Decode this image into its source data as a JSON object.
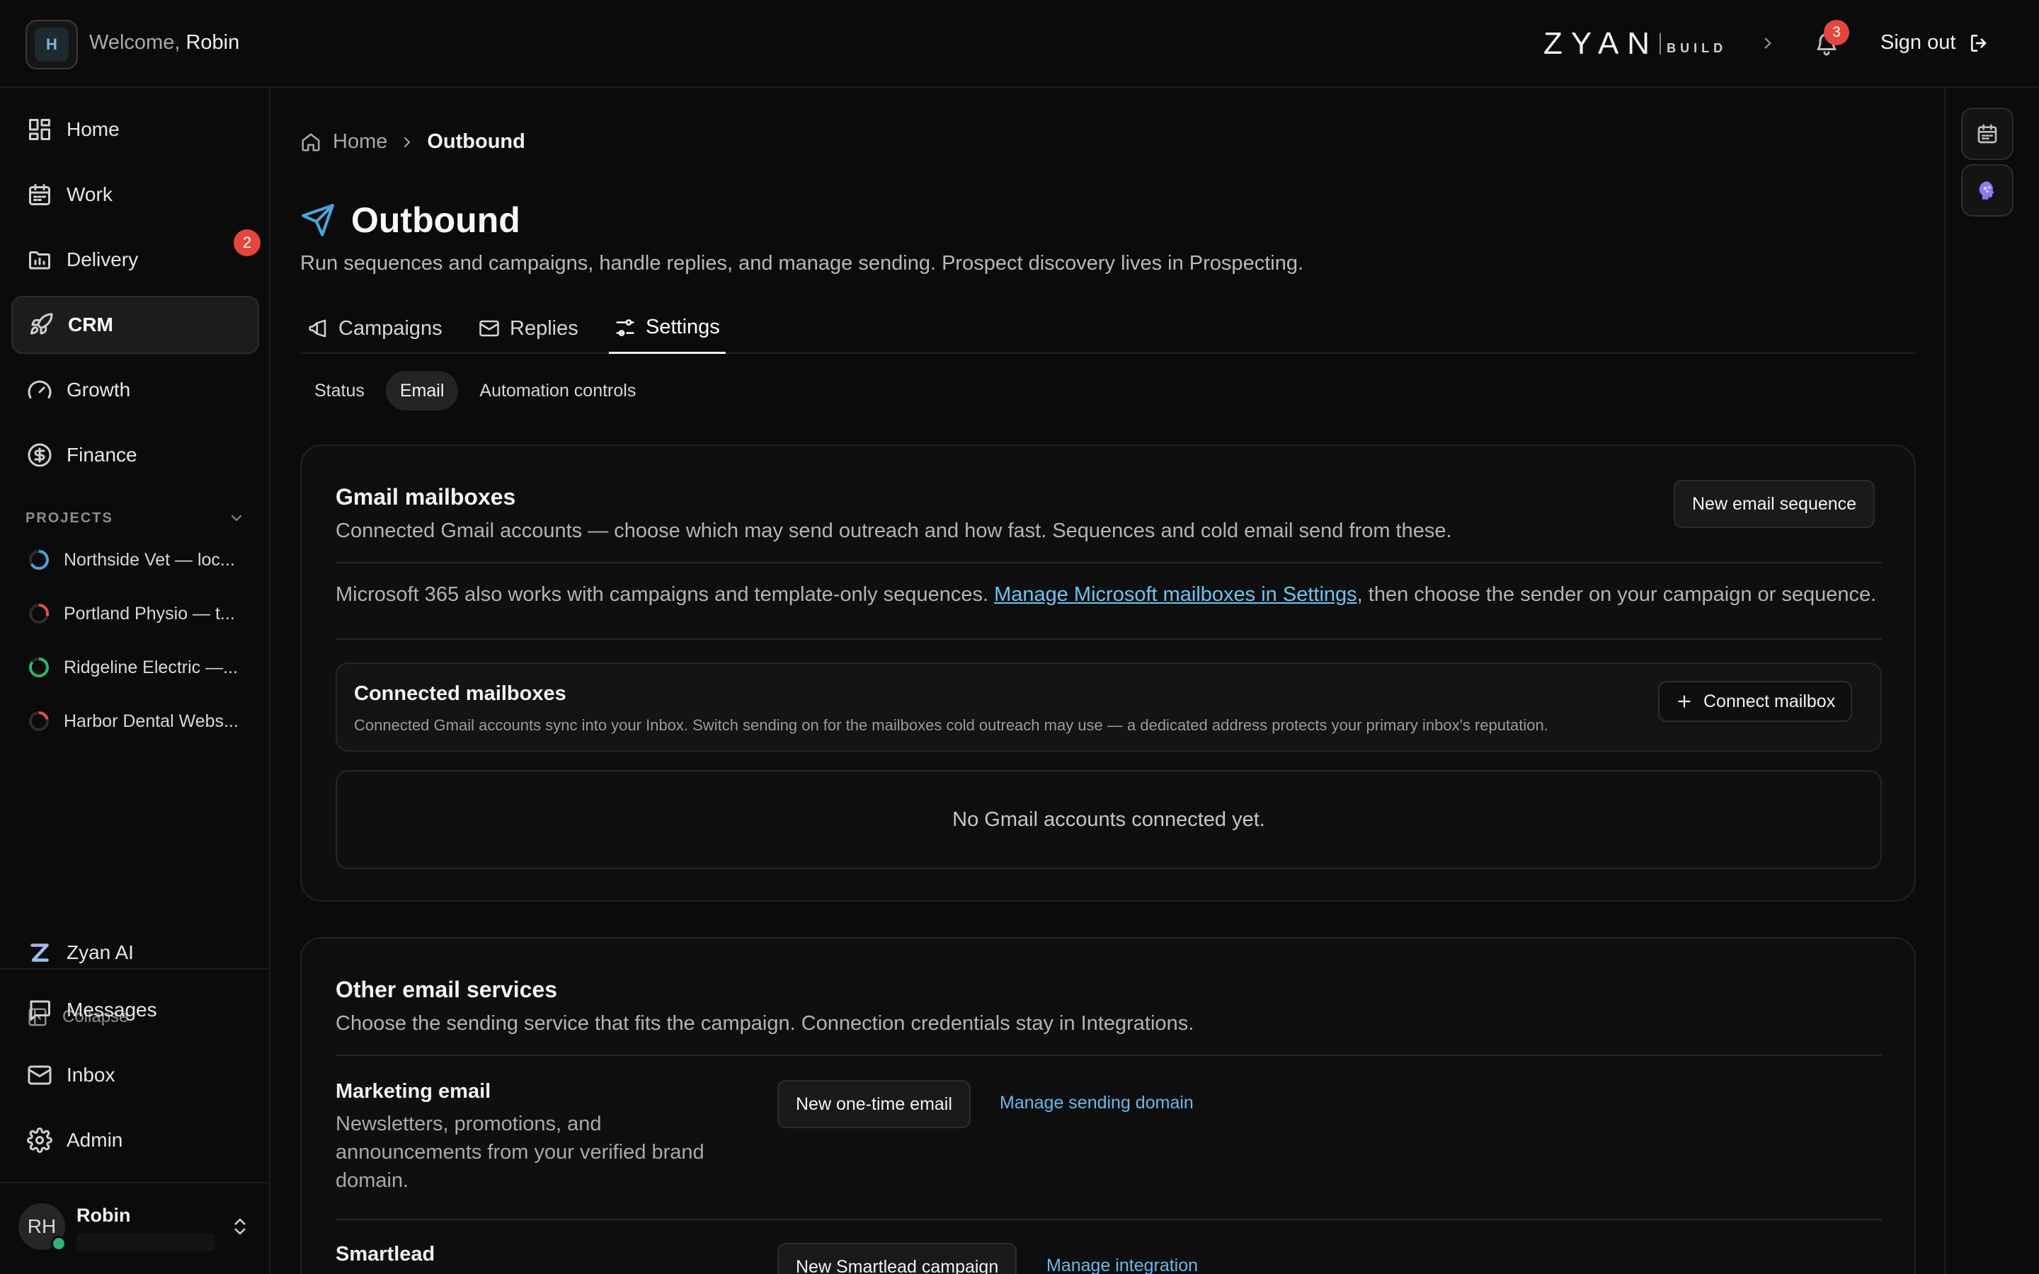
{
  "topbar": {
    "logo_initial": "H",
    "welcome_prefix": "Welcome,",
    "welcome_name": "Robin",
    "brand_name": "ZYAN",
    "brand_sub": "BUILD",
    "notifications_count": "3",
    "sign_out_label": "Sign out"
  },
  "sidebar": {
    "items": [
      {
        "label": "Home",
        "icon": "dashboard-icon"
      },
      {
        "label": "Work",
        "icon": "calendar-icon"
      },
      {
        "label": "Delivery",
        "icon": "delivery-icon",
        "badge": "2"
      },
      {
        "label": "CRM",
        "icon": "rocket-icon",
        "active": true
      },
      {
        "label": "Growth",
        "icon": "gauge-icon"
      },
      {
        "label": "Finance",
        "icon": "dollar-icon"
      }
    ],
    "projects_heading": "PROJECTS",
    "projects": [
      {
        "label": "Northside Vet — loc...",
        "ring_color": "#4aa3df"
      },
      {
        "label": "Portland Physio — t...",
        "ring_color": "#e5533c"
      },
      {
        "label": "Ridgeline Electric —...",
        "ring_color": "#2bb673"
      },
      {
        "label": "Harbor Dental Webs...",
        "ring_color": "#e5533c"
      }
    ],
    "zyan_ai_label": "Zyan AI",
    "collapse_label": "Collapse",
    "bottom_items": [
      {
        "label": "Messages",
        "icon": "message-icon"
      },
      {
        "label": "Inbox",
        "icon": "mail-icon"
      },
      {
        "label": "Admin",
        "icon": "gear-icon"
      }
    ],
    "user": {
      "initials": "RH",
      "name": "Robin",
      "status_color": "#2bb673"
    }
  },
  "breadcrumb": {
    "home": "Home",
    "current": "Outbound"
  },
  "page": {
    "title": "Outbound",
    "subtitle": "Run sequences and campaigns, handle replies, and manage sending. Prospect discovery lives in Prospecting."
  },
  "tabs": [
    {
      "label": "Campaigns",
      "icon": "megaphone-icon"
    },
    {
      "label": "Replies",
      "icon": "mail-icon"
    },
    {
      "label": "Settings",
      "icon": "sliders-icon",
      "active": true
    }
  ],
  "subtabs": [
    {
      "label": "Status"
    },
    {
      "label": "Email",
      "active": true
    },
    {
      "label": "Automation controls"
    }
  ],
  "gmail_card": {
    "title": "Gmail mailboxes",
    "description": "Connected Gmail accounts — choose which may send outreach and how fast. Sequences and cold email send from these.",
    "new_sequence_button": "New email sequence",
    "ms_note_prefix": "Microsoft 365 also works with campaigns and template-only sequences. ",
    "ms_note_link": "Manage Microsoft mailboxes in Settings",
    "ms_note_suffix": ", then choose the sender on your campaign or sequence.",
    "connected_title": "Connected mailboxes",
    "connected_desc": "Connected Gmail accounts sync into your Inbox. Switch sending on for the mailboxes cold outreach may use — a dedicated address protects your primary inbox's reputation.",
    "connect_button": "Connect mailbox",
    "empty_text": "No Gmail accounts connected yet."
  },
  "other_card": {
    "title": "Other email services",
    "description": "Choose the sending service that fits the campaign. Connection credentials stay in Integrations.",
    "services": [
      {
        "name": "Marketing email",
        "description": "Newsletters, promotions, and announcements from your verified brand domain.",
        "button": "New one-time email",
        "link": "Manage sending domain"
      },
      {
        "name": "Smartlead",
        "description": "",
        "button": "New Smartlead campaign",
        "link": "Manage integration"
      }
    ]
  },
  "colors": {
    "accent_link": "#6cb6e8",
    "badge_red": "#e5453c",
    "background": "#0b0b0b"
  }
}
